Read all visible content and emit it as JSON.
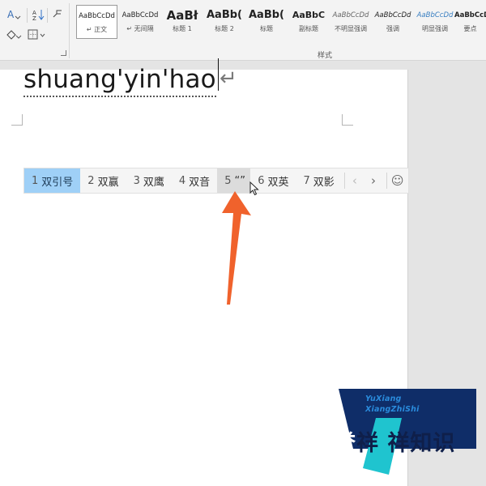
{
  "ribbon": {
    "styles": [
      {
        "sample": "AaBbCcDd",
        "name": "↵ 正文",
        "selected": true
      },
      {
        "sample": "AaBbCcDd",
        "name": "↵ 无间隔"
      },
      {
        "sample": "AaBł",
        "name": "标题 1"
      },
      {
        "sample": "AaBb(",
        "name": "标题 2"
      },
      {
        "sample": "AaBb(",
        "name": "标题"
      },
      {
        "sample": "AaBbC",
        "name": "副标题"
      },
      {
        "sample": "AaBbCcDd",
        "name": "不明显强调"
      },
      {
        "sample": "AaBbCcDd",
        "name": "强调"
      },
      {
        "sample": "AaBbCcDd",
        "name": "明显强调"
      },
      {
        "sample": "AaBbCcDd",
        "name": "要点"
      }
    ],
    "group_label": "样式"
  },
  "document": {
    "typed_text": "shuang'yin'hao",
    "paragraph_mark": "↵"
  },
  "ime": {
    "candidates": [
      {
        "num": "1",
        "text": "双引号",
        "state": "selected"
      },
      {
        "num": "2",
        "text": "双赢",
        "state": ""
      },
      {
        "num": "3",
        "text": "双鹰",
        "state": ""
      },
      {
        "num": "4",
        "text": "双音",
        "state": ""
      },
      {
        "num": "5",
        "text": "“”",
        "state": "hover"
      },
      {
        "num": "6",
        "text": "双英",
        "state": ""
      },
      {
        "num": "7",
        "text": "双影",
        "state": ""
      }
    ],
    "prev": "‹",
    "next": "›",
    "emoji": "☺"
  },
  "watermark": {
    "latin_line1": "YuXiang",
    "latin_line2": "XiangZhiShi",
    "chinese_first": "誉",
    "chinese_rest": "祥 祥知识"
  },
  "colors": {
    "accent_arrow": "#f0622c",
    "candidate_selected": "#9fd0f7",
    "watermark_navy": "#0f2d68",
    "watermark_teal": "#1fc4cf"
  }
}
